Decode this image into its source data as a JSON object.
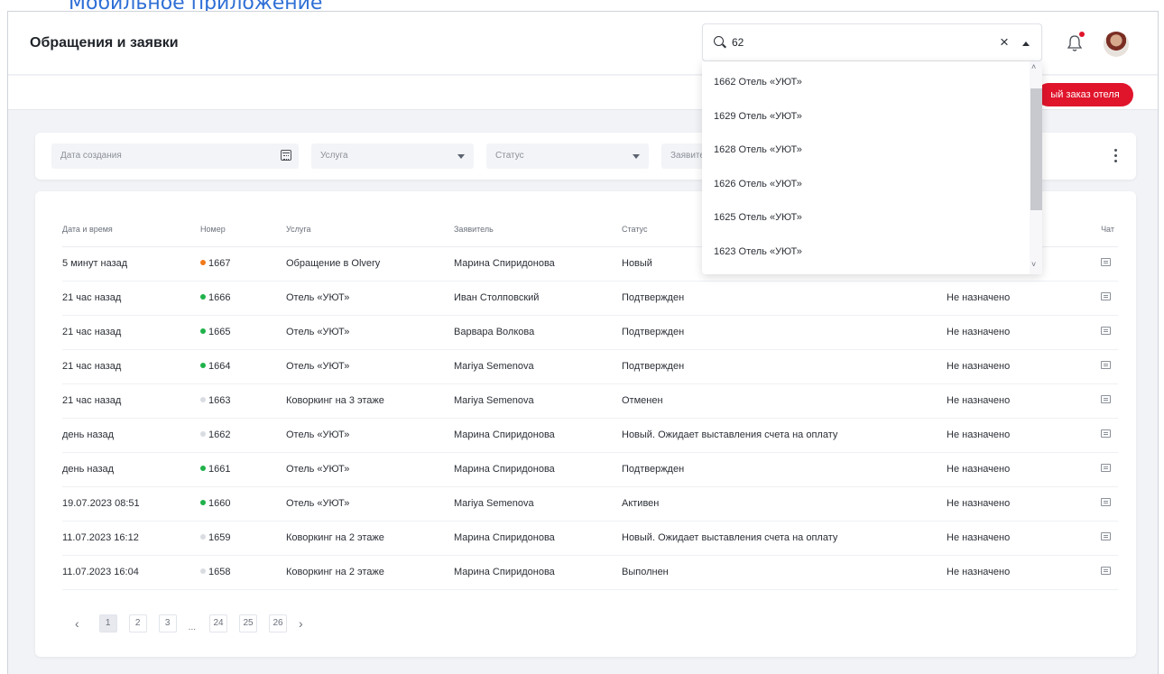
{
  "top_link": "Мобильное приложение",
  "header": {
    "title": "Обращения и заявки"
  },
  "new_order_button": "ый заказ отеля",
  "filters": {
    "created_date": "Дата создания",
    "service": "Услуга",
    "status": "Статус",
    "applicant": "Заявите"
  },
  "search": {
    "value": "62",
    "results": [
      "1662 Отель «УЮТ»",
      "1629 Отель «УЮТ»",
      "1628 Отель «УЮТ»",
      "1626 Отель «УЮТ»",
      "1625 Отель «УЮТ»",
      "1623 Отель «УЮТ»"
    ]
  },
  "table": {
    "columns": {
      "datetime": "Дата и время",
      "number": "Номер",
      "service": "Услуга",
      "applicant": "Заявитель",
      "status": "Статус",
      "chat": "Чат"
    },
    "rows": [
      {
        "datetime": "5 минут назад",
        "number": "1667",
        "dot": "#f07a1a",
        "service": "Обращение в Olvery",
        "applicant": "Марина Спиридонова",
        "status": "Новый",
        "assignee": ""
      },
      {
        "datetime": "21 час назад",
        "number": "1666",
        "dot": "#1fb24a",
        "service": "Отель «УЮТ»",
        "applicant": "Иван Столповский",
        "status": "Подтвержден",
        "assignee": "Не назначено"
      },
      {
        "datetime": "21 час назад",
        "number": "1665",
        "dot": "#1fb24a",
        "service": "Отель «УЮТ»",
        "applicant": "Варвара Волкова",
        "status": "Подтвержден",
        "assignee": "Не назначено"
      },
      {
        "datetime": "21 час назад",
        "number": "1664",
        "dot": "#1fb24a",
        "service": "Отель «УЮТ»",
        "applicant": "Mariya Semenova",
        "status": "Подтвержден",
        "assignee": "Не назначено"
      },
      {
        "datetime": "21 час назад",
        "number": "1663",
        "dot": "#d9dce1",
        "service": "Коворкинг на 3 этаже",
        "applicant": "Mariya Semenova",
        "status": "Отменен",
        "assignee": "Не назначено"
      },
      {
        "datetime": "день назад",
        "number": "1662",
        "dot": "#d9dce1",
        "service": "Отель «УЮТ»",
        "applicant": "Марина Спиридонова",
        "status": "Новый. Ожидает выставления счета на оплату",
        "assignee": "Не назначено"
      },
      {
        "datetime": "день назад",
        "number": "1661",
        "dot": "#1fb24a",
        "service": "Отель «УЮТ»",
        "applicant": "Марина Спиридонова",
        "status": "Подтвержден",
        "assignee": "Не назначено"
      },
      {
        "datetime": "19.07.2023 08:51",
        "number": "1660",
        "dot": "#1fb24a",
        "service": "Отель «УЮТ»",
        "applicant": "Mariya Semenova",
        "status": "Активен",
        "assignee": "Не назначено"
      },
      {
        "datetime": "11.07.2023 16:12",
        "number": "1659",
        "dot": "#d9dce1",
        "service": "Коворкинг на 2 этаже",
        "applicant": "Марина Спиридонова",
        "status": "Новый. Ожидает выставления счета на оплату",
        "assignee": "Не назначено"
      },
      {
        "datetime": "11.07.2023 16:04",
        "number": "1658",
        "dot": "#d9dce1",
        "service": "Коворкинг на 2 этаже",
        "applicant": "Марина Спиридонова",
        "status": "Выполнен",
        "assignee": "Не назначено"
      }
    ]
  },
  "pagination": {
    "prev": "‹",
    "next": "›",
    "ellipsis": "...",
    "pages_start": [
      "1",
      "2",
      "3"
    ],
    "pages_end": [
      "24",
      "25",
      "26"
    ],
    "active": "1"
  },
  "colors": {
    "accent": "#e0142b",
    "link": "#2f6fd6"
  }
}
